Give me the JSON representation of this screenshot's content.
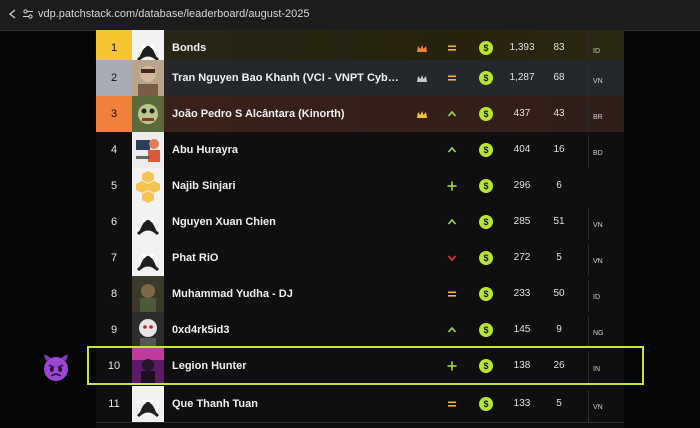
{
  "browser": {
    "url": "vdp.patchstack.com/database/leaderboard/august-2025"
  },
  "leaderboard": {
    "rows": [
      {
        "rank": "1",
        "name": "Bonds",
        "score": "1,393",
        "count": "83",
        "country": "ID",
        "trend": "equal",
        "crown": "bronze-crown"
      },
      {
        "rank": "2",
        "name": "Tran Nguyen Bao Khanh (VCI - VNPT Cyber Immu...",
        "score": "1,287",
        "count": "68",
        "country": "VN",
        "trend": "equal",
        "crown": "silver-crown"
      },
      {
        "rank": "3",
        "name": "João Pedro S Alcântara (Kinorth)",
        "score": "437",
        "count": "43",
        "country": "BR",
        "trend": "up",
        "crown": "gold-crown"
      },
      {
        "rank": "4",
        "name": "Abu Hurayra",
        "score": "404",
        "count": "16",
        "country": "BD",
        "trend": "up"
      },
      {
        "rank": "5",
        "name": "Najib Sinjari",
        "score": "296",
        "count": "6",
        "country": "",
        "trend": "new"
      },
      {
        "rank": "6",
        "name": "Nguyen Xuan Chien",
        "score": "285",
        "count": "51",
        "country": "VN",
        "trend": "up"
      },
      {
        "rank": "7",
        "name": "Phat RiO",
        "score": "272",
        "count": "5",
        "country": "VN",
        "trend": "down"
      },
      {
        "rank": "8",
        "name": "Muhammad Yudha - DJ",
        "score": "233",
        "count": "50",
        "country": "ID",
        "trend": "equal"
      },
      {
        "rank": "9",
        "name": "0xd4rk5id3",
        "score": "145",
        "count": "9",
        "country": "NG",
        "trend": "up"
      },
      {
        "rank": "10",
        "name": "Legion Hunter",
        "score": "138",
        "count": "26",
        "country": "IN",
        "trend": "new"
      },
      {
        "rank": "11",
        "name": "Que Thanh Tuan",
        "score": "133",
        "count": "5",
        "country": "VN",
        "trend": "equal"
      }
    ]
  },
  "colors": {
    "accent": "#c8e63a",
    "coin": "#b8e62e",
    "gold": "#f5c531",
    "silver": "#a9adb3",
    "bronze": "#f0803c",
    "trend_equal": "#f3b62b",
    "trend_up": "#a6d93a",
    "trend_down": "#e2452b"
  }
}
